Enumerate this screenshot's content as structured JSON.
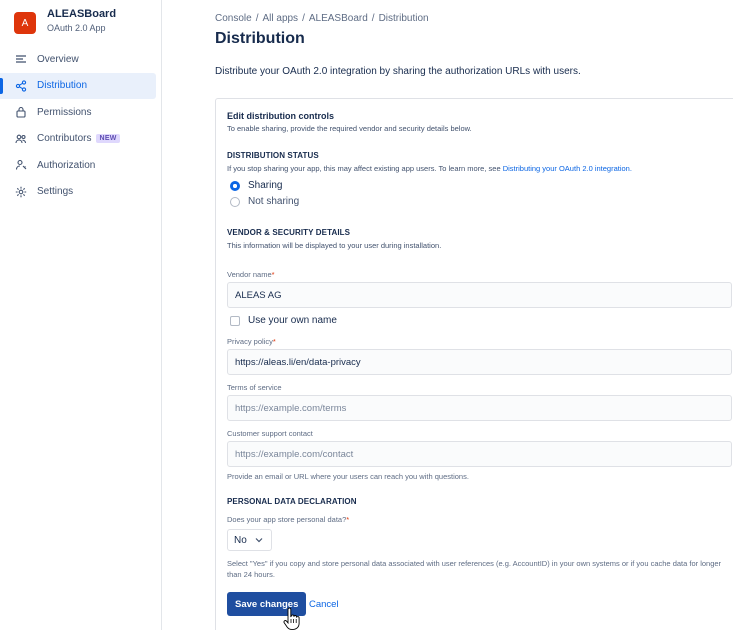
{
  "sidebar": {
    "app_initial": "A",
    "app_name": "ALEASBoard",
    "app_type": "OAuth 2.0 App",
    "items": [
      {
        "label": "Overview",
        "icon": "lines-icon"
      },
      {
        "label": "Distribution",
        "icon": "share-icon",
        "active": true
      },
      {
        "label": "Permissions",
        "icon": "lock-icon"
      },
      {
        "label": "Contributors",
        "icon": "people-icon",
        "badge": "NEW"
      },
      {
        "label": "Authorization",
        "icon": "person-key-icon"
      },
      {
        "label": "Settings",
        "icon": "gear-icon"
      }
    ]
  },
  "breadcrumb": [
    "Console",
    "All apps",
    "ALEASBoard",
    "Distribution"
  ],
  "breadcrumb_sep": "/",
  "page_title": "Distribution",
  "intro": "Distribute your OAuth 2.0 integration by sharing the authorization URLs with users.",
  "controls": {
    "title": "Edit distribution controls",
    "desc": "To enable sharing, provide the required vendor and security details below."
  },
  "distribution_status": {
    "heading": "DISTRIBUTION STATUS",
    "desc": "If you stop sharing your app, this may affect existing app users. To learn more, see ",
    "link": "Distributing your OAuth 2.0 integration.",
    "options": [
      "Sharing",
      "Not sharing"
    ],
    "selected": "Sharing"
  },
  "vendor": {
    "heading": "VENDOR & SECURITY DETAILS",
    "desc": "This information will be displayed to your user during installation.",
    "vendor_label": "Vendor name",
    "vendor_value": "ALEAS AG",
    "own_name_label": "Use your own name",
    "privacy_label": "Privacy policy",
    "privacy_value": "https://aleas.li/en/data-privacy",
    "terms_label": "Terms of service",
    "terms_placeholder": "https://example.com/terms",
    "support_label": "Customer support contact",
    "support_placeholder": "https://example.com/contact",
    "support_help": "Provide an email or URL where your users can reach you with questions."
  },
  "personal_data": {
    "heading": "PERSONAL DATA DECLARATION",
    "question": "Does your app store personal data?",
    "selected": "No",
    "help": "Select \"Yes\" if you copy and store personal data associated with user references (e.g. AccountID) in your own systems or if you cache data for longer than 24 hours."
  },
  "actions": {
    "save": "Save changes",
    "cancel": "Cancel"
  },
  "required_mark": "*",
  "colors": {
    "accent": "#0c66e4",
    "primary_button": "#1f4ea0",
    "avatar": "#de350b"
  }
}
